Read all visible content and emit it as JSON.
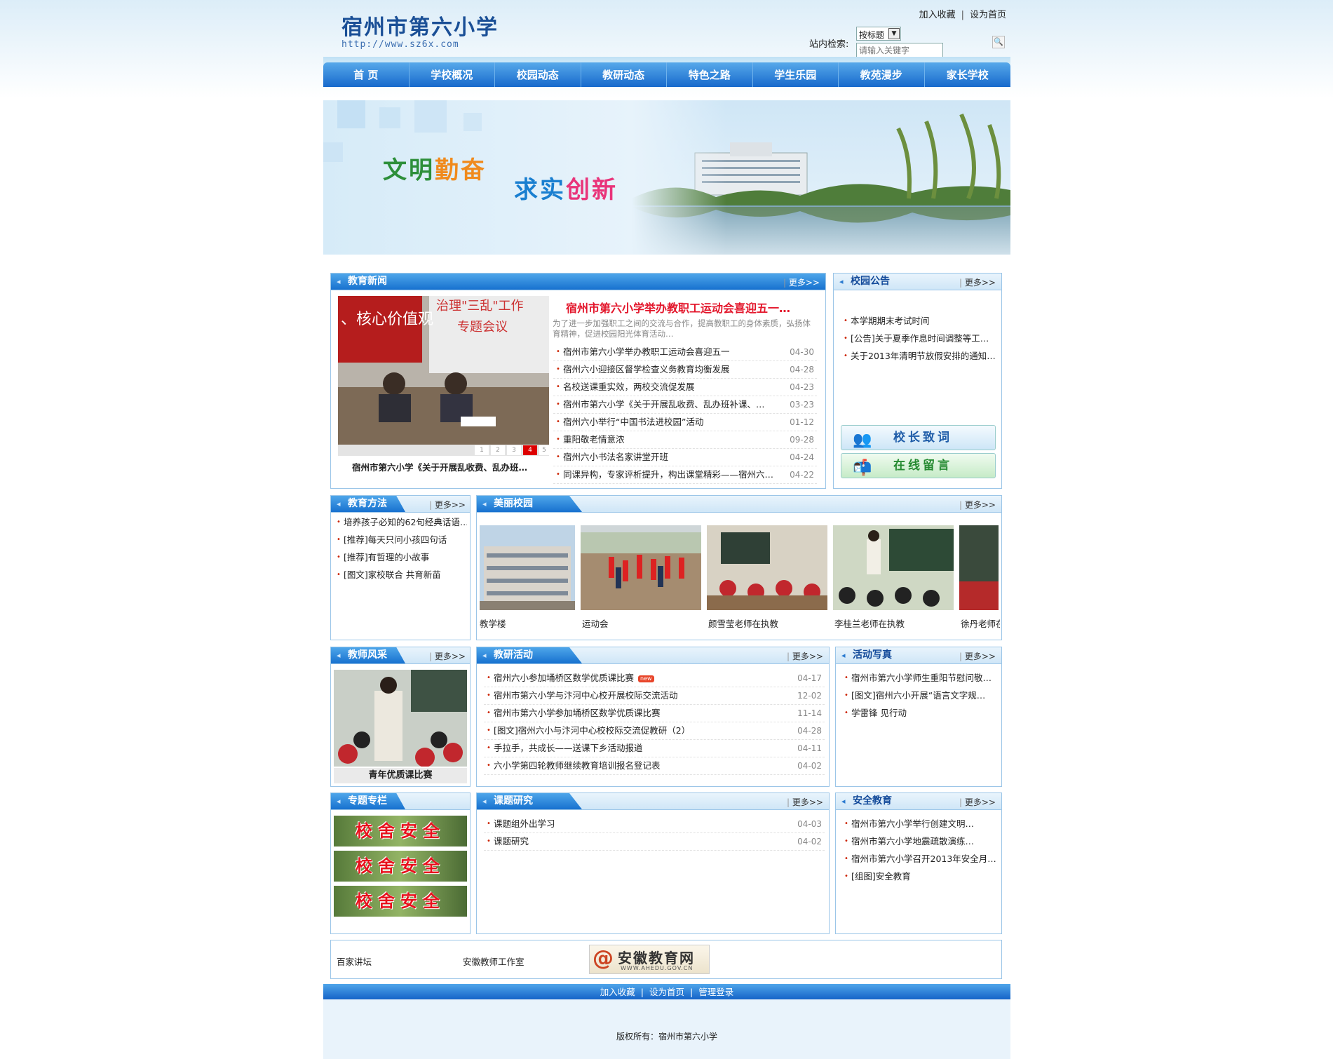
{
  "header": {
    "site_name": "宿州市第六小学",
    "url": "http://www.sz6x.com",
    "links": [
      "加入收藏",
      "设为首页"
    ],
    "search_label": "站内检索:",
    "search_select": "按标题",
    "search_placeholder": "请输入关键字"
  },
  "nav": [
    "首 页",
    "学校概况",
    "校园动态",
    "教研动态",
    "特色之路",
    "学生乐园",
    "教苑漫步",
    "家长学校"
  ],
  "banner": {
    "slogan1a": "文明",
    "slogan1b": "勤奋",
    "slogan2a": "求实",
    "slogan2b": "创新"
  },
  "more_label": "更多",
  "edu_news": {
    "title": "教育新闻",
    "slide_caption": "宿州市第六小学《关于开展乱收费、乱办班…",
    "slide_pages": [
      "1",
      "2",
      "3",
      "4",
      "5"
    ],
    "slide_active": 4,
    "headline": "宿州市第六小学举办教职工运动会喜迎五一…",
    "summary": "为了进一步加强职工之间的交流与合作，提高教职工的身体素质，弘扬体育精神，促进校园阳光体育活动…",
    "items": [
      {
        "t": "宿州市第六小学举办教职工运动会喜迎五一",
        "d": "04-30"
      },
      {
        "t": "宿州六小迎接区督学检查义务教育均衡发展",
        "d": "04-28"
      },
      {
        "t": "名校送课重实效，两校交流促发展",
        "d": "04-23"
      },
      {
        "t": "宿州市第六小学《关于开展乱收费、乱办班补课、…",
        "d": "03-23"
      },
      {
        "t": "宿州六小举行“中国书法进校园”活动",
        "d": "01-12"
      },
      {
        "t": "重阳敬老情意浓",
        "d": "09-28"
      },
      {
        "t": "宿州六小书法名家讲堂开班",
        "d": "04-24"
      },
      {
        "t": "同课异构，专家评析提升，构出课堂精彩——宿州六…",
        "d": "04-22"
      }
    ]
  },
  "notice": {
    "title": "校园公告",
    "items": [
      "本学期期末考试时间",
      "[公告]关于夏季作息时间调整等工…",
      "关于2013年清明节放假安排的通知…"
    ],
    "btn1": "校长致词",
    "btn2": "在线留言"
  },
  "methods": {
    "title": "教育方法",
    "items": [
      "培养孩子必知的62句经典话语…",
      "[推荐]每天只问小孩四句话",
      "[推荐]有哲理的小故事",
      "[图文]家校联合 共育新苗"
    ]
  },
  "campus": {
    "title": "美丽校园",
    "photos": [
      "教学楼",
      "运动会",
      "颜雪莹老师在执教",
      "李桂兰老师在执教",
      "徐丹老师在"
    ]
  },
  "teachers": {
    "title": "教师风采",
    "caption": "青年优质课比赛"
  },
  "research": {
    "title": "教研活动",
    "items": [
      {
        "t": "宿州六小参加埇桥区数学优质课比赛",
        "d": "04-17",
        "hot": "new"
      },
      {
        "t": "宿州市第六小学与汴河中心校开展校际交流活动",
        "d": "12-02"
      },
      {
        "t": "宿州市第六小学参加埇桥区数学优质课比赛",
        "d": "11-14"
      },
      {
        "t": "[图文]宿州六小与汴河中心校校际交流促教研（2）",
        "d": "04-28"
      },
      {
        "t": "手拉手，共成长——送课下乡活动报道",
        "d": "04-11"
      },
      {
        "t": "六小学第四轮教师继续教育培训报名登记表",
        "d": "04-02"
      }
    ]
  },
  "photos_act": {
    "title": "活动写真",
    "items": [
      "宿州市第六小学师生重阳节慰问敬…",
      "[图文]宿州六小开展“语言文字规…",
      "学雷锋 见行动"
    ]
  },
  "special": {
    "title": "专题专栏",
    "banner_text": "校舍安全"
  },
  "topics": {
    "title": "课题研究",
    "items": [
      {
        "t": "课题组外出学习",
        "d": "04-03"
      },
      {
        "t": "课题研究",
        "d": "04-02"
      }
    ]
  },
  "safety": {
    "title": "安全教育",
    "items": [
      "宿州市第六小学举行创建文明…",
      "宿州市第六小学地震疏散演练…",
      "宿州市第六小学召开2013年安全月…",
      "[组图]安全教育"
    ]
  },
  "friend_links": {
    "link1": "百家讲坛",
    "link2": "安徽教师工作室",
    "logo_text": "安徽教育网",
    "logo_url": "WWW.AHEDU.GOV.CN"
  },
  "footer": {
    "links": [
      "加入收藏",
      "设为首页",
      "管理登录"
    ],
    "copyright": "版权所有：宿州市第六小学"
  },
  "colors": {
    "primary": "#1769cc",
    "accent_red": "#e3162b",
    "title_blue": "#134a9a"
  }
}
